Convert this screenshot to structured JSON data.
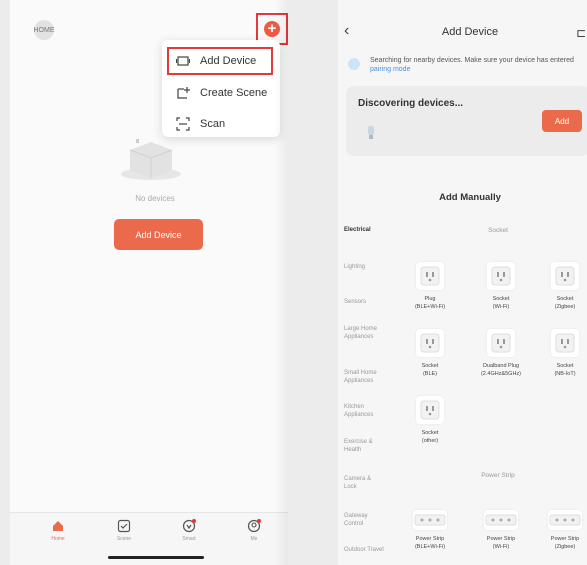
{
  "left": {
    "home_label": "HOME",
    "menu": [
      {
        "icon": "add-device-icon",
        "label": "Add Device"
      },
      {
        "icon": "create-scene-icon",
        "label": "Create Scene"
      },
      {
        "icon": "scan-icon",
        "label": "Scan"
      }
    ],
    "empty_text": "No devices",
    "add_button": "Add Device",
    "tabs": [
      {
        "label": "Home",
        "icon": "home-icon",
        "active": true
      },
      {
        "label": "Scene",
        "icon": "scene-icon",
        "active": false
      },
      {
        "label": "Smart",
        "icon": "smart-icon",
        "active": false
      },
      {
        "label": "Me",
        "icon": "me-icon",
        "active": false
      }
    ]
  },
  "right": {
    "title": "Add Device",
    "search_text": "Searching for nearby devices. Make sure your device has entered",
    "search_link": "pairing mode",
    "discovering_title": "Discovering devices...",
    "discover_add_button": "Add",
    "add_manually_title": "Add Manually",
    "categories": [
      "Electrical",
      "Lighting",
      "Sensors",
      "Large Home Appliances",
      "Small Home Appliances",
      "Kitchen Appliances",
      "Exercise & Health",
      "Camera & Lock",
      "Gateway Control",
      "Outdoor Travel"
    ],
    "sections": [
      {
        "title": "Socket",
        "devices": [
          {
            "name": "Plug",
            "sub": "(BLE+Wi-Fi)"
          },
          {
            "name": "Socket",
            "sub": "(Wi-Fi)"
          },
          {
            "name": "Socket",
            "sub": "(Zigbee)"
          },
          {
            "name": "Socket",
            "sub": "(BLE)"
          },
          {
            "name": "Dualband Plug",
            "sub": "(2.4GHz&5GHz)"
          },
          {
            "name": "Socket",
            "sub": "(NB-IoT)"
          },
          {
            "name": "Socket",
            "sub": "(other)"
          }
        ]
      },
      {
        "title": "Power Strip",
        "devices": [
          {
            "name": "Power Strip",
            "sub": "(BLE+Wi-Fi)"
          },
          {
            "name": "Power Strip",
            "sub": "(Wi-Fi)"
          },
          {
            "name": "Power Strip",
            "sub": "(Zigbee)"
          }
        ]
      }
    ]
  },
  "colors": {
    "accent": "#ec6a4c",
    "highlight": "#e03a3a",
    "link": "#4a90e2"
  }
}
